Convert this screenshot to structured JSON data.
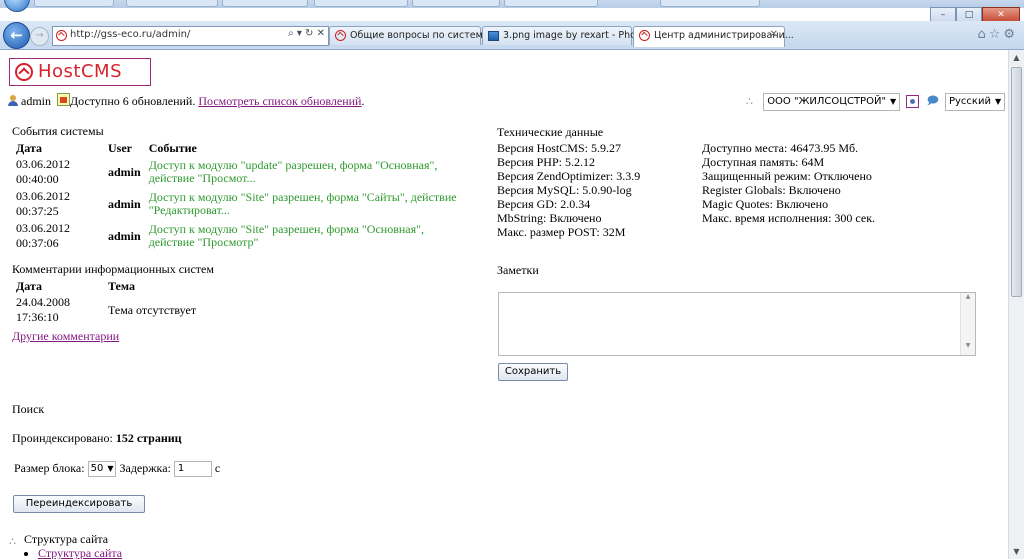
{
  "browser": {
    "address": "http://gss-eco.ru/admin/",
    "address_tools": "⌕ ▾ ↻ ✕",
    "tabs": [
      {
        "label": "Общие вопросы по системе ..."
      },
      {
        "label": "3.png image by rexart - Photo..."
      },
      {
        "label": "Центр администрировани...",
        "close": "✕"
      }
    ],
    "window_controls": {
      "minimize": "–",
      "maximize": "□",
      "close": "✕"
    },
    "right_icons": "⌂☆⚙"
  },
  "header": {
    "logo_text": "HostCMS",
    "username": "admin",
    "updates_text": "Доступно 6 обновлений.",
    "updates_link": "Посмотреть список обновлений",
    "site_select": "ООО \"ЖИЛСОЦСТРОЙ\"",
    "language_select": "Русский"
  },
  "events": {
    "title": "События системы",
    "columns": {
      "date": "Дата",
      "user": "User",
      "event": "Событие"
    },
    "rows": [
      {
        "date1": "03.06.2012",
        "date2": "00:40:00",
        "user": "admin",
        "event": "Доступ к модулю \"update\" разрешен, форма \"Основная\", действие \"Просмот..."
      },
      {
        "date1": "03.06.2012",
        "date2": "00:37:25",
        "user": "admin",
        "event": "Доступ к модулю \"Site\" разрешен, форма \"Сайты\", действие \"Редактироват..."
      },
      {
        "date1": "03.06.2012",
        "date2": "00:37:06",
        "user": "admin",
        "event": "Доступ к модулю \"Site\" разрешен, форма \"Основная\", действие \"Просмотр\""
      }
    ]
  },
  "comments": {
    "title": "Комментарии информационных систем",
    "columns": {
      "date": "Дата",
      "topic": "Тема"
    },
    "rows": [
      {
        "date1": "24.04.2008",
        "date2": "17:36:10",
        "topic": "Тема отсутствует"
      }
    ],
    "other_link": "Другие комментарии"
  },
  "tech": {
    "title": "Технические данные",
    "left": [
      "Версия HostCMS: 5.9.27",
      "Версия PHP: 5.2.12",
      "Версия ZendOptimizer: 3.3.9",
      "Версия MySQL: 5.0.90-log",
      "Версия GD: 2.0.34",
      "MbString: Включено",
      "Макс. размер POST: 32M"
    ],
    "right": [
      "Доступно места: 46473.95 Мб.",
      "Доступная память: 64M",
      "Защищенный режим: Отключено",
      "Register Globals: Включено",
      "Magic Quotes: Включено",
      "Макс. время исполнения: 300 сек."
    ]
  },
  "notes": {
    "title": "Заметки",
    "value": "",
    "save_label": "Сохранить"
  },
  "search": {
    "title": "Поиск",
    "indexed_label": "Проиндексировано:",
    "indexed_value": "152 страниц",
    "block_label": "Размер блока:",
    "block_value": "50",
    "delay_label": "Задержка:",
    "delay_value": "1",
    "delay_unit": "с",
    "reindex_label": "Переиндексировать"
  },
  "structure": {
    "title": "Структура сайта",
    "items": [
      "Структура сайта"
    ]
  }
}
